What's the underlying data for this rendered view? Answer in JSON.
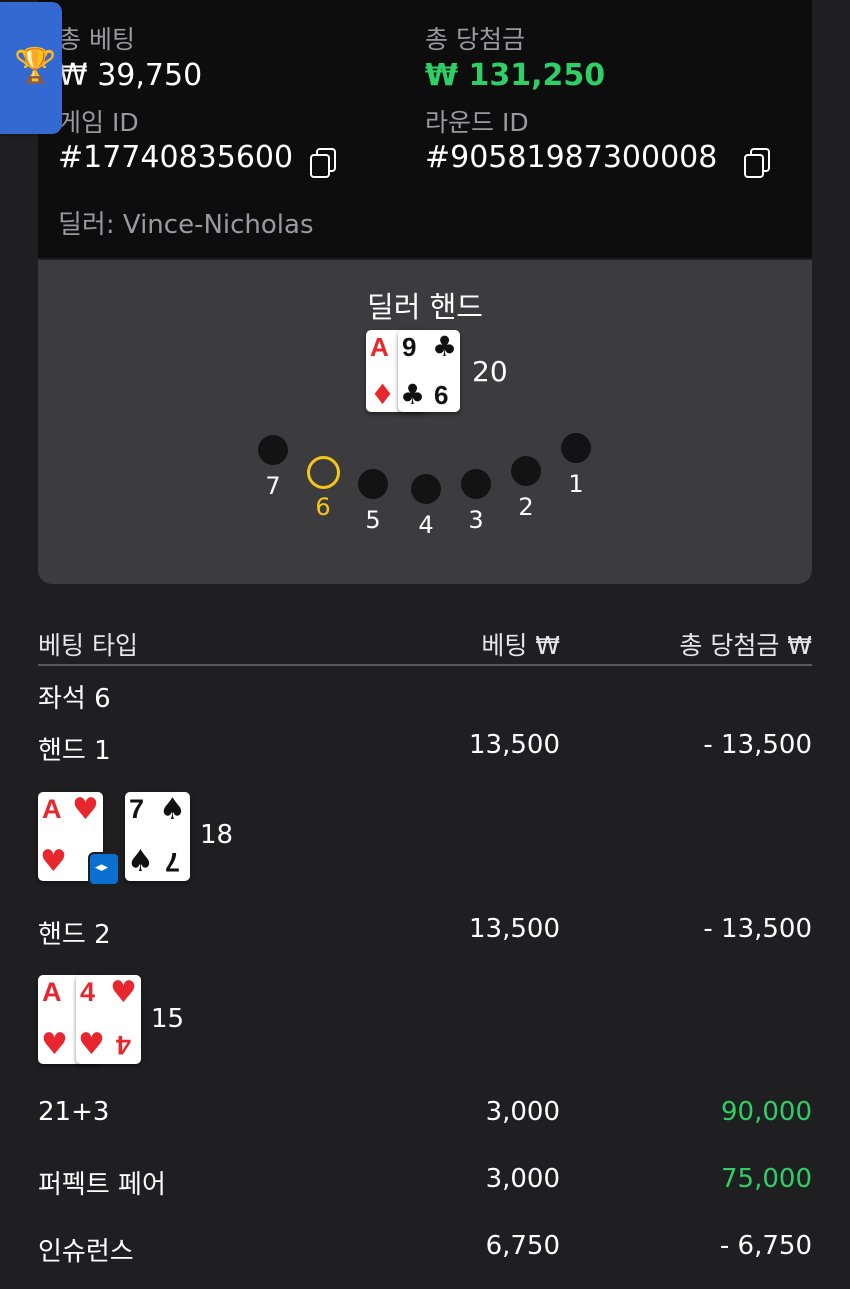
{
  "summary": {
    "total_bet_label": "총 베팅",
    "total_bet_value": "₩ 39,750",
    "total_win_label": "총 당첨금",
    "total_win_value": "₩ 131,250",
    "game_id_label": "게임 ID",
    "game_id_value": "#17740835600",
    "round_id_label": "라운드 ID",
    "round_id_value": "#90581987300008",
    "dealer_text": "딜러: Vince-Nicholas"
  },
  "dealer_hand": {
    "title": "딜러 핸드",
    "cards": [
      {
        "rank": "A",
        "suit": "♦"
      },
      {
        "rank": "9",
        "suit": "♣"
      },
      {
        "rank": "6",
        "suit": "♣"
      }
    ],
    "score": "20"
  },
  "seats": [
    "7",
    "6",
    "5",
    "4",
    "3",
    "2",
    "1"
  ],
  "active_seat": "6",
  "table_headers": {
    "bet_type": "베팅 타입",
    "bet": "베팅 ₩",
    "total_win": "총 당첨금 ₩"
  },
  "seat_label": "좌석 6",
  "rows": {
    "hand1": {
      "label": "핸드 1",
      "bet": "13,500",
      "win": "- 13,500",
      "score": "18"
    },
    "hand2": {
      "label": "핸드 2",
      "bet": "13,500",
      "win": "- 13,500",
      "score": "15"
    },
    "side1": {
      "label": "21+3",
      "bet": "3,000",
      "win": "90,000"
    },
    "side2": {
      "label": "퍼펙트 페어",
      "bet": "3,000",
      "win": "75,000"
    },
    "insurance": {
      "label": "인슈런스",
      "bet": "6,750",
      "win": "- 6,750"
    }
  },
  "hand1_cards": [
    {
      "rank": "A",
      "suit": "♥"
    },
    {
      "rank": "7",
      "suit": "♠"
    }
  ],
  "hand2_cards": [
    {
      "rank": "A",
      "suit": "♥"
    },
    {
      "rank": "4",
      "suit": "♥"
    }
  ],
  "icons": {
    "trophy": "🏆",
    "split": "◂▸"
  },
  "colors": {
    "win_green": "#2fce66",
    "active_seat_yellow": "#f5c518",
    "badge_blue": "#3469d2",
    "card_red": "#e8262e"
  }
}
